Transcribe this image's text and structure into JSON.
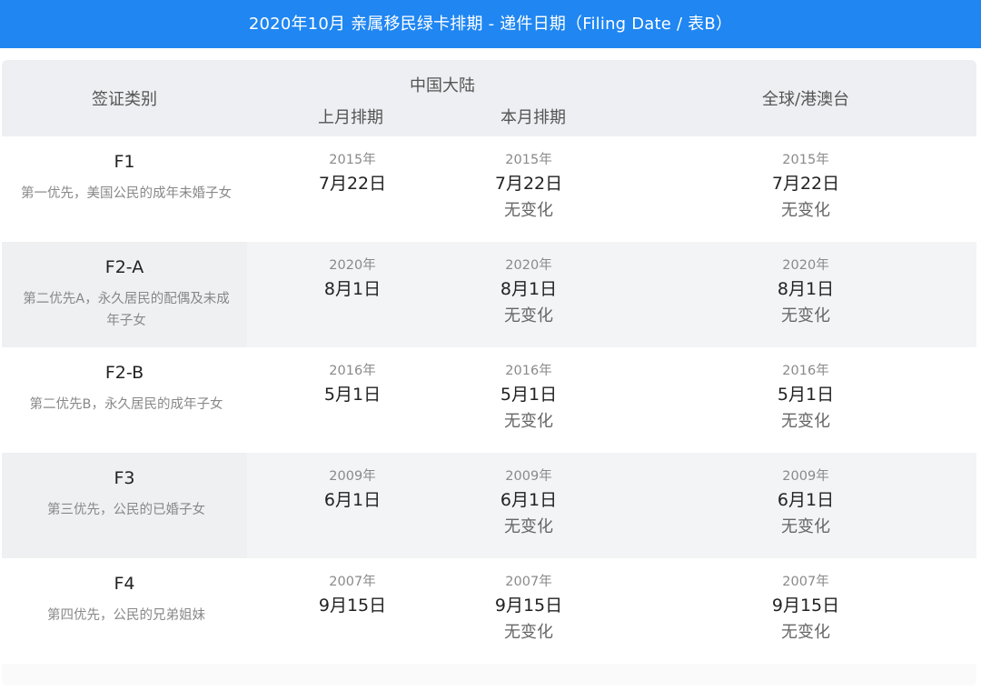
{
  "header": {
    "title": "2020年10月 亲属移民绿卡排期 - 递件日期（Filing Date / 表B）"
  },
  "table": {
    "columns": {
      "category": "签证类别",
      "mainland": "中国大陆",
      "last_month": "上月排期",
      "this_month": "本月排期",
      "global": "全球/港澳台"
    },
    "rows": [
      {
        "code": "F1",
        "desc": "第一优先，美国公民的成年未婚子女",
        "prev": {
          "year": "2015年",
          "md": "7月22日"
        },
        "curr": {
          "year": "2015年",
          "md": "7月22日",
          "change": "无变化"
        },
        "global": {
          "year": "2015年",
          "md": "7月22日",
          "change": "无变化"
        }
      },
      {
        "code": "F2-A",
        "desc": "第二优先A，永久居民的配偶及未成年子女",
        "prev": {
          "year": "2020年",
          "md": "8月1日"
        },
        "curr": {
          "year": "2020年",
          "md": "8月1日",
          "change": "无变化"
        },
        "global": {
          "year": "2020年",
          "md": "8月1日",
          "change": "无变化"
        }
      },
      {
        "code": "F2-B",
        "desc": "第二优先B，永久居民的成年子女",
        "prev": {
          "year": "2016年",
          "md": "5月1日"
        },
        "curr": {
          "year": "2016年",
          "md": "5月1日",
          "change": "无变化"
        },
        "global": {
          "year": "2016年",
          "md": "5月1日",
          "change": "无变化"
        }
      },
      {
        "code": "F3",
        "desc": "第三优先，公民的已婚子女",
        "prev": {
          "year": "2009年",
          "md": "6月1日"
        },
        "curr": {
          "year": "2009年",
          "md": "6月1日",
          "change": "无变化"
        },
        "global": {
          "year": "2009年",
          "md": "6月1日",
          "change": "无变化"
        }
      },
      {
        "code": "F4",
        "desc": "第四优先，公民的兄弟姐妹",
        "prev": {
          "year": "2007年",
          "md": "9月15日"
        },
        "curr": {
          "year": "2007年",
          "md": "9月15日",
          "change": "无变化"
        },
        "global": {
          "year": "2007年",
          "md": "9月15日",
          "change": "无变化"
        }
      }
    ]
  },
  "colors": {
    "banner": "#1f86f2",
    "header_bg": "#eeeff2",
    "alt_row": "#f3f4f6"
  }
}
